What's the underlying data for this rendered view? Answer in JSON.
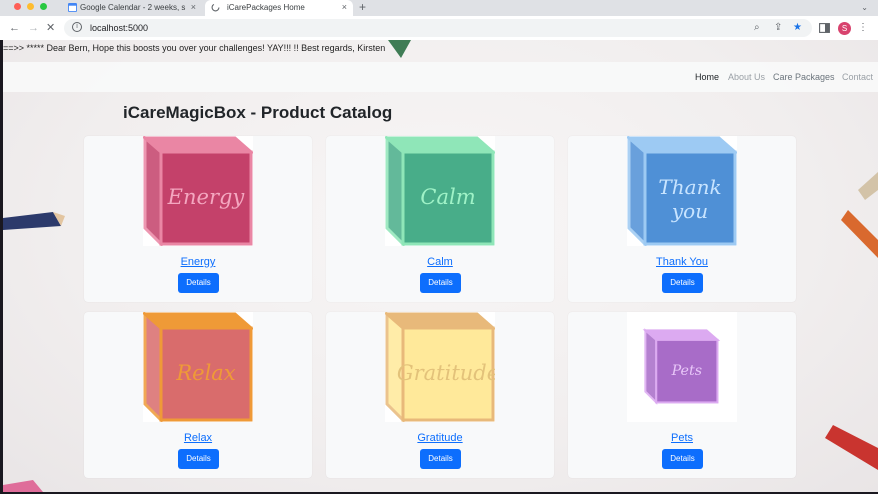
{
  "browser": {
    "tabs": [
      {
        "title": "Google Calendar - 2 weeks, s",
        "active": false
      },
      {
        "title": "iCarePackages Home",
        "active": true
      }
    ],
    "url": "localhost:5000",
    "profile_initial": "S",
    "new_tab_symbol": "+",
    "tab_close_symbol": "×"
  },
  "page": {
    "announcement": "==>> ***** Dear Bern, Hope this boosts you over your challenges! YAY!!! !! Best regards, Kirsten",
    "nav": {
      "items": [
        "Home",
        "About Us",
        "Care Packages",
        "Contact"
      ],
      "active_color": "#212529",
      "muted_color": "#9aa0a6"
    },
    "title": "iCareMagicBox - Product Catalog",
    "details_label": "Details",
    "products": [
      {
        "name": "Energy",
        "icon": "energy-cube",
        "cube_word": "Energy",
        "face": "#c4416a",
        "edge": "#ea86a4",
        "text_color": "#f4a7c0"
      },
      {
        "name": "Calm",
        "icon": "calm-cube",
        "cube_word": "Calm",
        "face": "#48ad89",
        "edge": "#8fe6b8",
        "text_color": "#9ff2c7"
      },
      {
        "name": "Thank You",
        "icon": "thank-you-cube",
        "cube_word": "Thank you",
        "face": "#4f90d6",
        "edge": "#9dcaf3",
        "text_color": "#c8e4ff"
      },
      {
        "name": "Relax",
        "icon": "relax-cube",
        "cube_word": "Relax",
        "face": "#d96c6c",
        "edge": "#ef9a37",
        "text_color": "#ef9a37"
      },
      {
        "name": "Gratitude",
        "icon": "gratitude-cube",
        "cube_word": "Gratitude",
        "face": "#ffe99a",
        "edge": "#e8b97a",
        "text_color": "#e3c27a"
      },
      {
        "name": "Pets",
        "icon": "pets-cube",
        "cube_word": "Pets",
        "face": "#a86cc8",
        "edge": "#dcaaf1",
        "text_color": "#e8c6f8"
      }
    ]
  }
}
